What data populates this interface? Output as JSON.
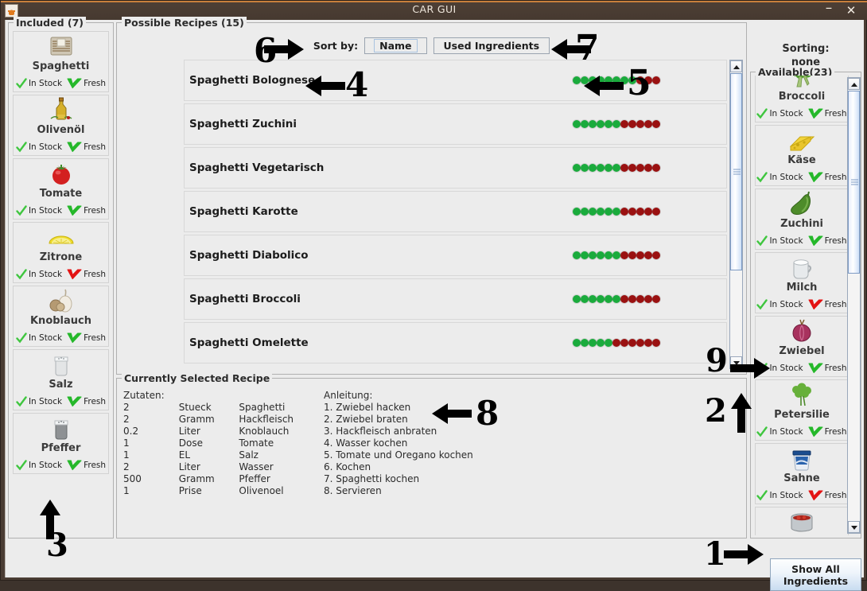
{
  "window": {
    "title": "CAR GUI",
    "icon": "java-coffee-icon",
    "minimize": "–",
    "close": "✕"
  },
  "left_panel": {
    "title": "Included (7)",
    "items": [
      {
        "name": "Spaghetti",
        "img": "spaghetti-pack",
        "in_stock_label": "In Stock",
        "in_stock": true,
        "fresh_label": "Fresh",
        "fresh": true
      },
      {
        "name": "Olivenöl",
        "img": "olive-oil-bottle",
        "in_stock_label": "In Stock",
        "in_stock": true,
        "fresh_label": "Fresh",
        "fresh": true
      },
      {
        "name": "Tomate",
        "img": "tomato",
        "in_stock_label": "In Stock",
        "in_stock": true,
        "fresh_label": "Fresh",
        "fresh": true
      },
      {
        "name": "Zitrone",
        "img": "lemon-half",
        "in_stock_label": "In Stock",
        "in_stock": true,
        "fresh_label": "Fresh",
        "fresh": false
      },
      {
        "name": "Knoblauch",
        "img": "garlic",
        "in_stock_label": "In Stock",
        "in_stock": true,
        "fresh_label": "Fresh",
        "fresh": true
      },
      {
        "name": "Salz",
        "img": "salt-shaker",
        "in_stock_label": "In Stock",
        "in_stock": true,
        "fresh_label": "Fresh",
        "fresh": true
      },
      {
        "name": "Pfeffer",
        "img": "pepper-shaker",
        "in_stock_label": "In Stock",
        "in_stock": true,
        "fresh_label": "Fresh",
        "fresh": true
      }
    ]
  },
  "recipes_panel": {
    "title": "Possible Recipes (15)",
    "sort_label": "Sort by:",
    "sort_buttons": [
      {
        "label": "Name",
        "focused": true
      },
      {
        "label": "Used Ingredients",
        "focused": false
      }
    ],
    "rows": [
      {
        "name": "Spaghetti Bolognese",
        "green": 8,
        "red": 3
      },
      {
        "name": "Spaghetti Zuchini",
        "green": 6,
        "red": 5
      },
      {
        "name": "Spaghetti Vegetarisch",
        "green": 6,
        "red": 5
      },
      {
        "name": "Spaghetti Karotte",
        "green": 6,
        "red": 5
      },
      {
        "name": "Spaghetti Diabolico",
        "green": 6,
        "red": 5
      },
      {
        "name": "Spaghetti Broccoli",
        "green": 6,
        "red": 5
      },
      {
        "name": "Spaghetti Omelette",
        "green": 5,
        "red": 6
      }
    ]
  },
  "selected_panel": {
    "title": "Currently Selected Recipe",
    "ingredients_header": "Zutaten:",
    "instructions_header": "Anleitung:",
    "ingredients": [
      {
        "qty": "2",
        "unit": "Stueck",
        "name": "Spaghetti"
      },
      {
        "qty": "2",
        "unit": "Gramm",
        "name": "Hackfleisch"
      },
      {
        "qty": "0.2",
        "unit": "Liter",
        "name": "Knoblauch"
      },
      {
        "qty": "1",
        "unit": "Dose",
        "name": "Tomate"
      },
      {
        "qty": "1",
        "unit": "EL",
        "name": "Salz"
      },
      {
        "qty": "2",
        "unit": "Liter",
        "name": "Wasser"
      },
      {
        "qty": "500",
        "unit": "Gramm",
        "name": "Pfeffer"
      },
      {
        "qty": "1",
        "unit": "Prise",
        "name": "Olivenoel"
      }
    ],
    "instructions": [
      "1. Zwiebel hacken",
      "2. Zwiebel braten",
      "3. Hackfleisch anbraten",
      "4. Wasser kochen",
      "5. Tomate und Oregano kochen",
      "6. Kochen",
      "7. Spaghetti kochen",
      "8. Servieren"
    ]
  },
  "right_panel": {
    "sorting_line1": "Sorting:",
    "sorting_line2": "none",
    "title": "Available(23)",
    "items": [
      {
        "name": "Broccoli",
        "img": "broccoli",
        "in_stock_label": "In Stock",
        "in_stock": true,
        "fresh_label": "Fresh",
        "fresh": true
      },
      {
        "name": "Käse",
        "img": "cheese",
        "in_stock_label": "In Stock",
        "in_stock": true,
        "fresh_label": "Fresh",
        "fresh": true
      },
      {
        "name": "Zuchini",
        "img": "zucchini",
        "in_stock_label": "In Stock",
        "in_stock": true,
        "fresh_label": "Fresh",
        "fresh": true
      },
      {
        "name": "Milch",
        "img": "milk-jug",
        "in_stock_label": "In Stock",
        "in_stock": true,
        "fresh_label": "Fresh",
        "fresh": false
      },
      {
        "name": "Zwiebel",
        "img": "onion",
        "in_stock_label": "In Stock",
        "in_stock": true,
        "fresh_label": "Fresh",
        "fresh": true
      },
      {
        "name": "Petersilie",
        "img": "parsley",
        "in_stock_label": "In Stock",
        "in_stock": true,
        "fresh_label": "Fresh",
        "fresh": true
      },
      {
        "name": "Sahne",
        "img": "cream-tub",
        "in_stock_label": "In Stock",
        "in_stock": true,
        "fresh_label": "Fresh",
        "fresh": false
      },
      {
        "name": "",
        "img": "tomato-can",
        "in_stock_label": "",
        "in_stock": true,
        "fresh_label": "",
        "fresh": true
      }
    ]
  },
  "footer": {
    "show_all_line1": "Show All",
    "show_all_line2": "Ingredients"
  },
  "annotations": [
    {
      "id": "1",
      "number": "1",
      "direction": "right"
    },
    {
      "id": "2",
      "number": "2",
      "direction": "up"
    },
    {
      "id": "3",
      "number": "3",
      "direction": "up"
    },
    {
      "id": "4",
      "number": "4",
      "direction": "left"
    },
    {
      "id": "5",
      "number": "5",
      "direction": "left"
    },
    {
      "id": "6",
      "number": "6",
      "direction": "right"
    },
    {
      "id": "7",
      "number": "7",
      "direction": "left"
    },
    {
      "id": "8",
      "number": "8",
      "direction": "left"
    },
    {
      "id": "9",
      "number": "9",
      "direction": "right"
    }
  ],
  "colors": {
    "titlebar": "#463930",
    "accent_top": "#c87f3c",
    "panel_bg": "#ececec",
    "dot_green": "#1aab3c",
    "dot_red": "#9a1111",
    "tick_green": "#2fbe2f",
    "tick_red": "#e01b1b",
    "scrollbar_thumb": "#cfe0f7"
  }
}
